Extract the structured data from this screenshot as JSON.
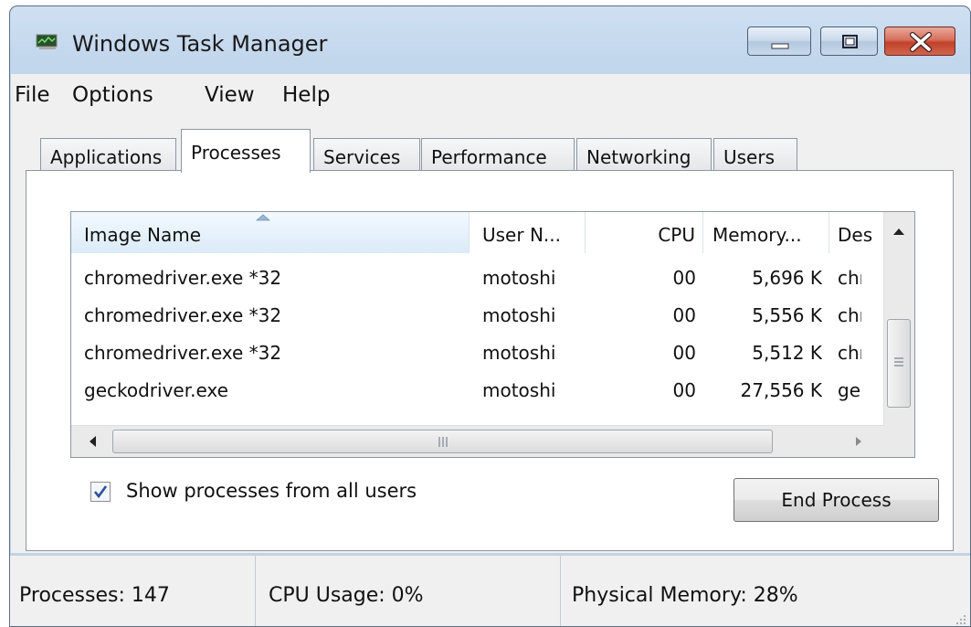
{
  "window": {
    "title": "Windows Task Manager"
  },
  "menu": [
    "File",
    "Options",
    "View",
    "Help"
  ],
  "tabs": [
    {
      "label": "Applications"
    },
    {
      "label": "Processes",
      "active": true
    },
    {
      "label": "Services"
    },
    {
      "label": "Performance"
    },
    {
      "label": "Networking"
    },
    {
      "label": "Users"
    }
  ],
  "table": {
    "headers": [
      "Image Name",
      "User N...",
      "CPU",
      "Memory...",
      "Des"
    ],
    "sorted_column": "Image Name",
    "rows": [
      {
        "image": "chromedriver.exe *32",
        "user": "motoshi",
        "cpu": "00",
        "memory": "5,696 K",
        "desc": "chr"
      },
      {
        "image": "chromedriver.exe *32",
        "user": "motoshi",
        "cpu": "00",
        "memory": "5,556 K",
        "desc": "chr"
      },
      {
        "image": "chromedriver.exe *32",
        "user": "motoshi",
        "cpu": "00",
        "memory": "5,512 K",
        "desc": "chr"
      },
      {
        "image": "geckodriver.exe",
        "user": "motoshi",
        "cpu": "00",
        "memory": "27,556 K",
        "desc": "gec"
      }
    ]
  },
  "controls": {
    "show_all_users_label": "Show processes from all users",
    "show_all_users_checked": true,
    "end_process_label": "End Process"
  },
  "status": {
    "processes": "Processes: 147",
    "cpu_usage": "CPU Usage: 0%",
    "physical_memory": "Physical Memory: 28%"
  },
  "colors": {
    "close_button": "#c2412b",
    "sorted_header": "#dbebf8",
    "frame": "#c2d6ec"
  },
  "icons": [
    "task-manager-app-icon",
    "minimize-icon",
    "maximize-icon",
    "close-icon",
    "sort-ascending-icon",
    "scroll-up-icon",
    "scroll-left-icon",
    "scroll-right-icon",
    "grip-icon",
    "checkmark-icon",
    "resize-grip-icon"
  ]
}
